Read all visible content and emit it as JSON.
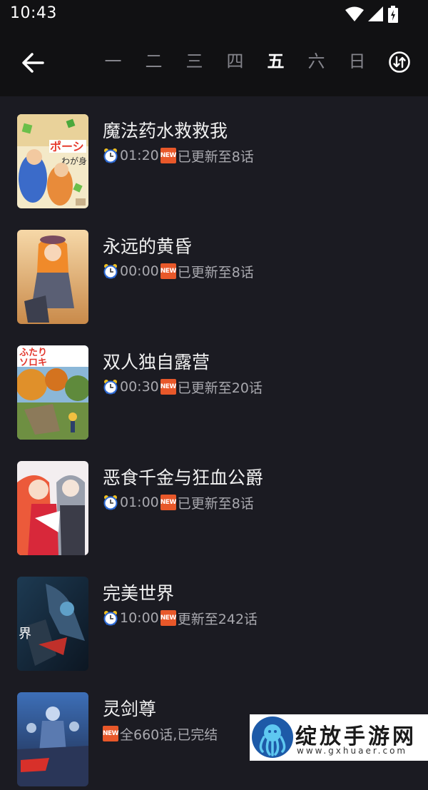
{
  "status_bar": {
    "time": "10:43"
  },
  "header": {
    "weekdays": [
      "一",
      "二",
      "三",
      "四",
      "五",
      "六",
      "日"
    ],
    "active_weekday": "五"
  },
  "shows": [
    {
      "title": "魔法药水救救我",
      "time": "01:20",
      "update": "已更新至8话",
      "show_clock": true
    },
    {
      "title": "永远的黄昏",
      "time": "00:00",
      "update": "已更新至8话",
      "show_clock": true
    },
    {
      "title": "双人独自露营",
      "time": "00:30",
      "update": "已更新至20话",
      "show_clock": true
    },
    {
      "title": "恶食千金与狂血公爵",
      "time": "01:00",
      "update": "已更新至8话",
      "show_clock": true
    },
    {
      "title": "完美世界",
      "time": "10:00",
      "update": "更新至242话",
      "show_clock": true
    },
    {
      "title": "灵剑尊",
      "time": "",
      "update": "全660话,已完结",
      "show_clock": false
    }
  ],
  "badge": {
    "text": "NEW"
  },
  "watermark": {
    "brand": "绽放手游网",
    "url": "www.gxhuaer.com"
  },
  "colors": {
    "background": "#1b1b22",
    "header": "#111113",
    "badge": "#e8582a",
    "active_day": "#ffffff",
    "inactive_day": "#85858c"
  }
}
